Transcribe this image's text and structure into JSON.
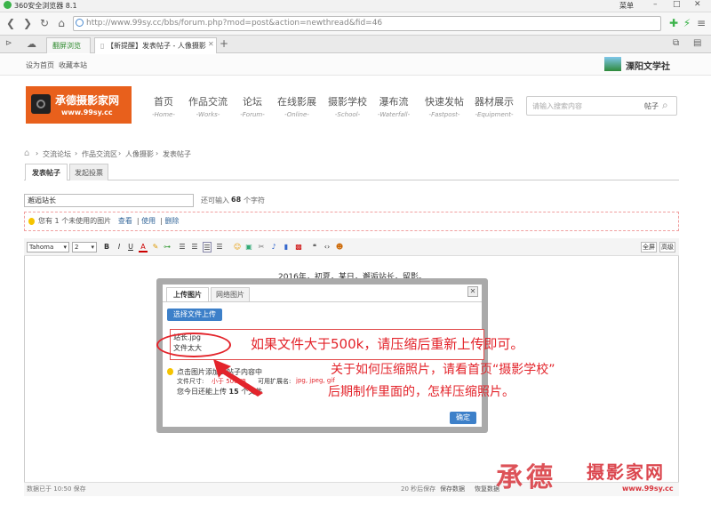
{
  "browser": {
    "title": "360安全浏览器 8.1",
    "menu_label": "菜单",
    "url": "http://www.99sy.cc/bbs/forum.php?mod=post&action=newthread&fid=46",
    "tabs": [
      {
        "label": "翻屏浏览"
      },
      {
        "label": "【新提醒】发表帖子 - 人像摄影"
      }
    ]
  },
  "site": {
    "top_links": [
      "设为首页",
      "收藏本站"
    ],
    "partner": "溧阳文学社",
    "logo_cn": "承德摄影家网",
    "logo_url": "www.99sy.cc",
    "nav": [
      {
        "cn": "首页",
        "en": "-Home-"
      },
      {
        "cn": "作品交流",
        "en": "-Works-"
      },
      {
        "cn": "论坛",
        "en": "-Forum-"
      },
      {
        "cn": "在线影展",
        "en": "-Online-"
      },
      {
        "cn": "摄影学校",
        "en": "-School-"
      },
      {
        "cn": "瀑布流",
        "en": "-Waterfall-"
      },
      {
        "cn": "快速发帖",
        "en": "-Fastpost-"
      },
      {
        "cn": "器材展示",
        "en": "-Equipment-"
      }
    ],
    "search_placeholder": "请输入搜索内容",
    "search_type": "帖子"
  },
  "breadcrumb": [
    "交流论坛",
    "作品交流区",
    "人像摄影",
    "发表帖子"
  ],
  "post_tabs": [
    "发表帖子",
    "发起投票"
  ],
  "subject": {
    "value": "邂逅站长",
    "hint_prefix": "还可输入",
    "hint_count": "68",
    "hint_suffix": "个字符"
  },
  "attachments": {
    "prefix": "您有",
    "count": "1",
    "suffix": "个未使用的图片",
    "actions": [
      "查看",
      "使用",
      "删除"
    ]
  },
  "editor": {
    "font": "Tahoma",
    "size": "2",
    "fullscreen": "全屏",
    "advanced": "高级",
    "content": "2016年，初夏，某日，邂逅站长，留影。",
    "saved_prefix": "数据已于",
    "saved_time": "10:50",
    "saved_suffix": "保存",
    "autosave": "20 秒后保存",
    "save_now": "保存数据",
    "restore": "恢复数据"
  },
  "modal": {
    "tabs": [
      "上传图片",
      "网络图片"
    ],
    "choose_button": "选择文件上传",
    "file_name": "站长.jpg",
    "error": "文件太大",
    "tip_line1": "点击图片添加到帖子内容中",
    "tip_size_label": "文件尺寸:",
    "tip_size_value": "小于 500KB",
    "tip_ext_label": "可用扩展名:",
    "tip_ext_value": "jpg, jpeg, gif",
    "tip_today_prefix": "您今日还能上传",
    "tip_today_count": "15",
    "tip_today_suffix": "个文件",
    "ok_button": "确定"
  },
  "annotations": {
    "line1": "如果文件大于500k，请压缩后重新上传即可。",
    "line2": "关于如何压缩照片，请看首页“摄影学校”",
    "line3": "后期制作里面的，怎样压缩照片。"
  },
  "watermark": {
    "brand1": "承德",
    "brand2": "摄影家网",
    "url": "www.99sy.cc"
  },
  "colors": {
    "accent_red": "#e3242b",
    "logo_orange": "#e8601c",
    "button_blue": "#3d80c9"
  }
}
